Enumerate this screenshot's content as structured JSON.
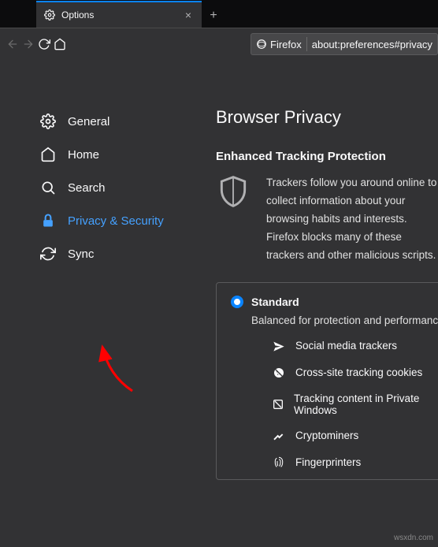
{
  "tab": {
    "title": "Options"
  },
  "urlbar": {
    "brand": "Firefox",
    "url": "about:preferences#privacy"
  },
  "sidebar": {
    "items": [
      {
        "label": "General"
      },
      {
        "label": "Home"
      },
      {
        "label": "Search"
      },
      {
        "label": "Privacy & Security"
      },
      {
        "label": "Sync"
      }
    ]
  },
  "main": {
    "title": "Browser Privacy",
    "subtitle": "Enhanced Tracking Protection",
    "description": "Trackers follow you around online to collect information about your browsing habits and interests. Firefox blocks many of these trackers and other malicious scripts.",
    "option": {
      "name": "Standard",
      "desc": "Balanced for protection and performance.",
      "trackers": [
        "Social media trackers",
        "Cross-site tracking cookies",
        "Tracking content in Private Windows",
        "Cryptominers",
        "Fingerprinters"
      ]
    }
  },
  "watermark": "wsxdn.com"
}
